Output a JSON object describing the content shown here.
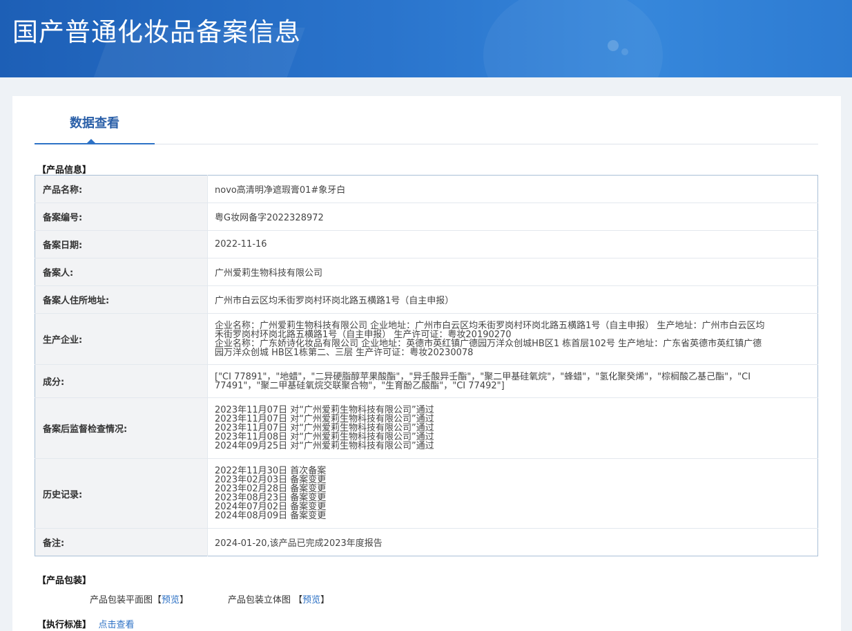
{
  "header": {
    "title": "国产普通化妆品备案信息"
  },
  "tab": {
    "label": "数据查看"
  },
  "sections": {
    "product_info": "【产品信息】",
    "packaging": "【产品包装】",
    "standard": "【执行标准】"
  },
  "fields": {
    "name": {
      "label": "产品名称:",
      "value": "novo高清明净遮瑕膏01#象牙白"
    },
    "record_no": {
      "label": "备案编号:",
      "value": "粤G妆网备字2022328972"
    },
    "record_date": {
      "label": "备案日期:",
      "value": "2022-11-16"
    },
    "registrant": {
      "label": "备案人:",
      "value": "广州爱莉生物科技有限公司"
    },
    "address": {
      "label": "备案人住所地址:",
      "value": "广州市白云区均禾街罗岗村环岗北路五横路1号（自主申报）"
    },
    "manufacturer": {
      "label": "生产企业:",
      "lines": [
        "企业名称：广州爱莉生物科技有限公司 企业地址：广州市白云区均禾街罗岗村环岗北路五横路1号（自主申报） 生产地址：广州市白云区均",
        "禾街罗岗村环岗北路五横路1号（自主申报） 生产许可证：粤妆20190270",
        "企业名称：广东娇诗化妆品有限公司 企业地址：英德市英红镇广德园万洋众创城HB区1 栋首层102号 生产地址：广东省英德市英红镇广德",
        "园万洋众创城 HB区1栋第二、三层 生产许可证：粤妆20230078"
      ]
    },
    "ingredients": {
      "label": "成分:",
      "lines": [
        "[\"CI 77891\"，\"地蜡\"，\"二异硬脂醇苹果酸酯\"，\"异壬酸异壬酯\"，\"聚二甲基硅氧烷\"，\"蜂蜡\"，\"氢化聚癸烯\"，\"棕榈酸乙基己酯\"，\"CI",
        "77491\"，\"聚二甲基硅氧烷交联聚合物\"，\"生育酚乙酸酯\"，\"CI 77492\"]"
      ]
    },
    "inspection": {
      "label": "备案后监督检查情况:",
      "lines": [
        "2023年11月07日 对“广州爱莉生物科技有限公司”通过",
        "2023年11月07日 对“广州爱莉生物科技有限公司”通过",
        "2023年11月07日 对“广州爱莉生物科技有限公司”通过",
        "2023年11月08日 对“广州爱莉生物科技有限公司”通过",
        "2024年09月25日 对“广州爱莉生物科技有限公司”通过"
      ]
    },
    "history": {
      "label": "历史记录:",
      "lines": [
        "2022年11月30日 首次备案",
        "2023年02月03日 备案变更",
        "2023年02月28日 备案变更",
        "2023年08月23日 备案变更",
        "2024年07月02日 备案变更",
        "2024年08月09日 备案变更"
      ]
    },
    "remarks": {
      "label": "备注:",
      "value": "2024-01-20,该产品已完成2023年度报告"
    }
  },
  "packaging": {
    "flat_label": "产品包装平面图",
    "flat_link": "预览",
    "solid_label": "产品包装立体图 ",
    "solid_link": "预览",
    "bracket_open": "【",
    "bracket_close": "】"
  },
  "standard": {
    "link": "点击查看"
  }
}
